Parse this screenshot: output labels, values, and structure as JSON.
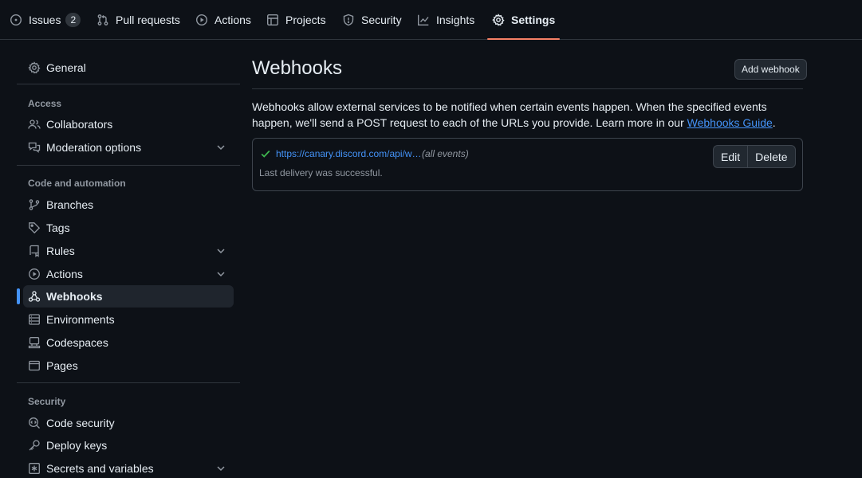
{
  "repo_nav": {
    "tabs": [
      {
        "label": "Issues",
        "counter": "2",
        "icon": "issue-opened-icon"
      },
      {
        "label": "Pull requests",
        "icon": "git-pull-request-icon"
      },
      {
        "label": "Actions",
        "icon": "play-icon"
      },
      {
        "label": "Projects",
        "icon": "table-icon"
      },
      {
        "label": "Security",
        "icon": "shield-icon"
      },
      {
        "label": "Insights",
        "icon": "graph-icon"
      },
      {
        "label": "Settings",
        "icon": "gear-icon",
        "selected": true
      }
    ]
  },
  "sidebar": {
    "general": "General",
    "access_heading": "Access",
    "collaborators": "Collaborators",
    "moderation": "Moderation options",
    "code_heading": "Code and automation",
    "branches": "Branches",
    "tags": "Tags",
    "rules": "Rules",
    "actions": "Actions",
    "webhooks": "Webhooks",
    "environments": "Environments",
    "codespaces": "Codespaces",
    "pages": "Pages",
    "security_heading": "Security",
    "code_security": "Code security",
    "deploy_keys": "Deploy keys",
    "secrets": "Secrets and variables"
  },
  "main": {
    "title": "Webhooks",
    "add_button": "Add webhook",
    "description": "Webhooks allow external services to be notified when certain events happen. When the specified events happen, we'll send a POST request to each of the URLs you provide. Learn more in our ",
    "guide_link": "Webhooks Guide",
    "description_end": ".",
    "webhook": {
      "url": "https://canary.discord.com/api/w…",
      "events": "(all events)",
      "status": "Last delivery was successful.",
      "edit_label": "Edit",
      "delete_label": "Delete"
    }
  },
  "colors": {
    "background": "#0d1117",
    "accent_underline": "#f78166",
    "link": "#4493f8",
    "success": "#3fb950"
  }
}
